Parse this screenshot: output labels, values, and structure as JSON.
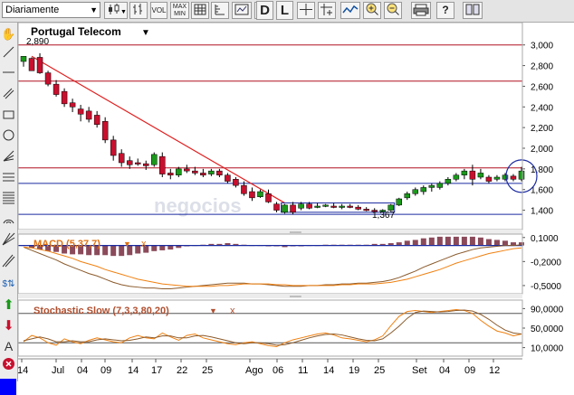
{
  "toolbar": {
    "period_select": "Diariamente",
    "vol_label": "VOL",
    "maxmin_label": "MAX MIN",
    "d_label": "D",
    "l_label": "L"
  },
  "chart": {
    "title": "Portugal Telecom",
    "high_label": "2,890",
    "low_label": "1,367",
    "watermark": "negocios"
  },
  "chart_data": [
    {
      "type": "candlestick",
      "title": "Portugal Telecom",
      "ylim": [
        1.3,
        3.05
      ],
      "yticks": [
        "3,000",
        "2,800",
        "2,600",
        "2,400",
        "2,200",
        "2,000",
        "1,800",
        "1,600",
        "1,400"
      ],
      "ytick_values": [
        3.0,
        2.8,
        2.6,
        2.4,
        2.2,
        2.0,
        1.8,
        1.6,
        1.4
      ],
      "horizontal_lines": [
        3.0,
        2.65,
        1.81,
        1.66,
        1.36
      ],
      "high_label": "2,890",
      "low_label": "1,367",
      "candles": [
        [
          2.84,
          2.89,
          2.79,
          2.89
        ],
        [
          2.87,
          2.88,
          2.76,
          2.75
        ],
        [
          2.88,
          2.92,
          2.72,
          2.73
        ],
        [
          2.73,
          2.75,
          2.6,
          2.62
        ],
        [
          2.62,
          2.66,
          2.5,
          2.52
        ],
        [
          2.55,
          2.58,
          2.4,
          2.43
        ],
        [
          2.44,
          2.48,
          2.35,
          2.4
        ],
        [
          2.38,
          2.42,
          2.26,
          2.33
        ],
        [
          2.36,
          2.4,
          2.25,
          2.28
        ],
        [
          2.32,
          2.36,
          2.2,
          2.23
        ],
        [
          2.26,
          2.3,
          2.05,
          2.08
        ],
        [
          2.08,
          2.12,
          1.88,
          1.93
        ],
        [
          1.95,
          1.99,
          1.82,
          1.86
        ],
        [
          1.88,
          1.92,
          1.8,
          1.84
        ],
        [
          1.86,
          1.9,
          1.83,
          1.85
        ],
        [
          1.85,
          1.88,
          1.79,
          1.83
        ],
        [
          1.84,
          1.96,
          1.82,
          1.94
        ],
        [
          1.92,
          1.96,
          1.72,
          1.75
        ],
        [
          1.76,
          1.8,
          1.7,
          1.74
        ],
        [
          1.74,
          1.82,
          1.72,
          1.8
        ],
        [
          1.8,
          1.84,
          1.76,
          1.78
        ],
        [
          1.78,
          1.82,
          1.74,
          1.76
        ],
        [
          1.76,
          1.8,
          1.72,
          1.74
        ],
        [
          1.75,
          1.8,
          1.73,
          1.78
        ],
        [
          1.78,
          1.8,
          1.72,
          1.74
        ],
        [
          1.74,
          1.76,
          1.66,
          1.68
        ],
        [
          1.7,
          1.72,
          1.62,
          1.64
        ],
        [
          1.64,
          1.68,
          1.54,
          1.56
        ],
        [
          1.58,
          1.62,
          1.49,
          1.52
        ],
        [
          1.53,
          1.6,
          1.52,
          1.58
        ],
        [
          1.56,
          1.6,
          1.47,
          1.48
        ],
        [
          1.46,
          1.48,
          1.38,
          1.4
        ],
        [
          1.38,
          1.46,
          1.367,
          1.45
        ],
        [
          1.45,
          1.48,
          1.36,
          1.38
        ],
        [
          1.42,
          1.48,
          1.4,
          1.46
        ],
        [
          1.46,
          1.48,
          1.41,
          1.42
        ],
        [
          1.43,
          1.47,
          1.42,
          1.44
        ],
        [
          1.44,
          1.46,
          1.43,
          1.45
        ],
        [
          1.44,
          1.47,
          1.42,
          1.43
        ],
        [
          1.43,
          1.46,
          1.41,
          1.44
        ],
        [
          1.44,
          1.46,
          1.42,
          1.43
        ],
        [
          1.43,
          1.45,
          1.4,
          1.41
        ],
        [
          1.41,
          1.43,
          1.39,
          1.4
        ],
        [
          1.4,
          1.42,
          1.38,
          1.39
        ],
        [
          1.39,
          1.41,
          1.38,
          1.4
        ],
        [
          1.4,
          1.46,
          1.39,
          1.45
        ],
        [
          1.45,
          1.52,
          1.44,
          1.51
        ],
        [
          1.52,
          1.58,
          1.5,
          1.56
        ],
        [
          1.56,
          1.62,
          1.54,
          1.6
        ],
        [
          1.58,
          1.64,
          1.55,
          1.62
        ],
        [
          1.62,
          1.66,
          1.58,
          1.64
        ],
        [
          1.62,
          1.68,
          1.6,
          1.66
        ],
        [
          1.66,
          1.72,
          1.64,
          1.7
        ],
        [
          1.7,
          1.76,
          1.68,
          1.74
        ],
        [
          1.74,
          1.8,
          1.7,
          1.78
        ],
        [
          1.78,
          1.84,
          1.64,
          1.7
        ],
        [
          1.72,
          1.8,
          1.7,
          1.76
        ],
        [
          1.72,
          1.74,
          1.66,
          1.68
        ],
        [
          1.7,
          1.74,
          1.68,
          1.72
        ],
        [
          1.7,
          1.76,
          1.68,
          1.74
        ],
        [
          1.73,
          1.75,
          1.68,
          1.7
        ],
        [
          1.7,
          1.82,
          1.68,
          1.78
        ]
      ]
    },
    {
      "type": "line",
      "title": "MACD (5,37,7)",
      "ylim": [
        -0.58,
        0.12
      ],
      "yticks": [
        "0,1000",
        "-0,2000",
        "-0,5000"
      ],
      "ytick_values": [
        0.1,
        -0.2,
        -0.5
      ],
      "macd": [
        -0.02,
        -0.06,
        -0.1,
        -0.14,
        -0.18,
        -0.23,
        -0.27,
        -0.31,
        -0.35,
        -0.38,
        -0.42,
        -0.46,
        -0.49,
        -0.51,
        -0.52,
        -0.53,
        -0.53,
        -0.54,
        -0.54,
        -0.53,
        -0.52,
        -0.51,
        -0.5,
        -0.49,
        -0.48,
        -0.47,
        -0.47,
        -0.47,
        -0.48,
        -0.48,
        -0.49,
        -0.5,
        -0.51,
        -0.51,
        -0.51,
        -0.5,
        -0.5,
        -0.49,
        -0.49,
        -0.48,
        -0.48,
        -0.47,
        -0.47,
        -0.46,
        -0.45,
        -0.43,
        -0.4,
        -0.36,
        -0.32,
        -0.27,
        -0.23,
        -0.19,
        -0.15,
        -0.11,
        -0.08,
        -0.05,
        -0.03,
        -0.02,
        -0.01,
        0.0,
        0.0,
        0.01
      ],
      "signal": [
        -0.02,
        -0.03,
        -0.05,
        -0.07,
        -0.1,
        -0.13,
        -0.16,
        -0.2,
        -0.23,
        -0.26,
        -0.3,
        -0.33,
        -0.36,
        -0.39,
        -0.42,
        -0.44,
        -0.46,
        -0.48,
        -0.49,
        -0.5,
        -0.51,
        -0.51,
        -0.51,
        -0.51,
        -0.5,
        -0.5,
        -0.49,
        -0.48,
        -0.48,
        -0.48,
        -0.48,
        -0.49,
        -0.49,
        -0.5,
        -0.5,
        -0.5,
        -0.5,
        -0.5,
        -0.5,
        -0.49,
        -0.49,
        -0.48,
        -0.48,
        -0.48,
        -0.47,
        -0.46,
        -0.44,
        -0.42,
        -0.39,
        -0.36,
        -0.33,
        -0.3,
        -0.26,
        -0.22,
        -0.19,
        -0.16,
        -0.13,
        -0.1,
        -0.08,
        -0.06,
        -0.04,
        -0.03
      ]
    },
    {
      "type": "line",
      "title": "Stochastic Slow (7,3,3,80,20)",
      "ylim": [
        0,
        100
      ],
      "yticks": [
        "90,0000",
        "50,0000",
        "10,0000"
      ],
      "ytick_values": [
        90,
        50,
        10
      ],
      "levels": [
        80,
        20
      ],
      "k": [
        22,
        35,
        30,
        20,
        15,
        28,
        22,
        18,
        25,
        30,
        26,
        22,
        20,
        30,
        35,
        30,
        28,
        40,
        32,
        25,
        35,
        38,
        30,
        26,
        22,
        18,
        16,
        20,
        22,
        18,
        14,
        12,
        20,
        26,
        30,
        34,
        38,
        40,
        36,
        30,
        28,
        25,
        22,
        26,
        34,
        55,
        74,
        84,
        86,
        84,
        82,
        84,
        86,
        88,
        86,
        80,
        66,
        54,
        44,
        40,
        34,
        38
      ],
      "d": [
        24,
        28,
        32,
        28,
        22,
        22,
        24,
        22,
        22,
        26,
        28,
        26,
        24,
        25,
        28,
        32,
        30,
        34,
        34,
        30,
        30,
        34,
        35,
        32,
        28,
        24,
        20,
        18,
        20,
        20,
        18,
        15,
        16,
        20,
        25,
        30,
        34,
        37,
        38,
        36,
        32,
        28,
        25,
        24,
        28,
        40,
        54,
        70,
        82,
        85,
        84,
        83,
        84,
        86,
        87,
        85,
        78,
        68,
        56,
        46,
        40,
        38
      ]
    }
  ],
  "xaxis": {
    "labels": [
      "14",
      "Jul",
      "04",
      "09",
      "14",
      "17",
      "22",
      "25",
      "Ago",
      "06",
      "11",
      "14",
      "19",
      "25",
      "Set",
      "04",
      "09",
      "12"
    ]
  },
  "macd_panel": {
    "title": "MACD (5,37,7)",
    "arrow": "▼",
    "close": "x"
  },
  "stoch_panel": {
    "title": "Stochastic Slow (7,3,3,80,20)",
    "arrow": "▼",
    "close": "x"
  },
  "colors": {
    "bull": "#1a9a1a",
    "bear": "#c8102e",
    "trend_line": "#e02020",
    "level_line": "#b01020",
    "blue_line": "#1a2aa0",
    "macd_line": "#8b5a2b",
    "signal_line": "#f08010",
    "hist": "#8b4a5a"
  }
}
